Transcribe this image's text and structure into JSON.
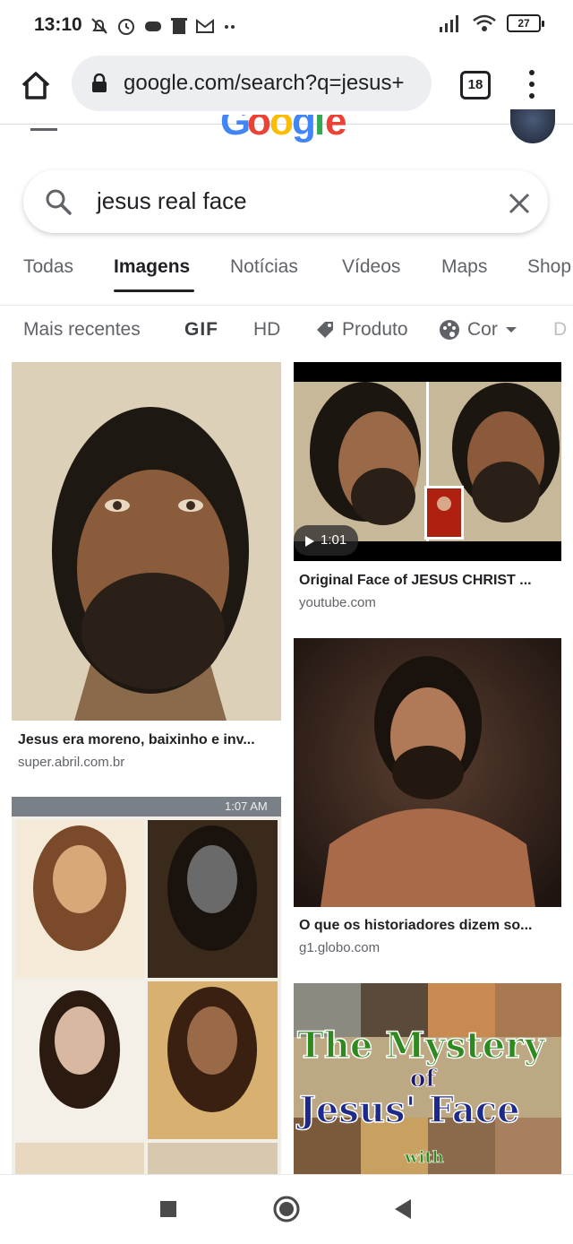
{
  "status_bar": {
    "time": "13:10",
    "battery": "27"
  },
  "browser": {
    "url": "google.com/search?q=jesus+",
    "tab_count": "18"
  },
  "search": {
    "query": "jesus real face"
  },
  "tabs": [
    "Todas",
    "Imagens",
    "Notícias",
    "Vídeos",
    "Maps",
    "Shop"
  ],
  "active_tab": "Imagens",
  "chips": {
    "recent": "Mais recentes",
    "gif": "GIF",
    "hd": "HD",
    "product": "Produto",
    "color": "Cor",
    "more": "D"
  },
  "results": [
    {
      "caption": "Jesus era moreno, baixinho e inv...",
      "source": "super.abril.com.br"
    },
    {
      "caption": "Original Face of JESUS CHRIST ...",
      "source": "youtube.com",
      "duration": "1:01"
    },
    {
      "caption": "O que os historiadores dizem so...",
      "source": "g1.globo.com"
    },
    {
      "overlay_time": "1:07 AM"
    },
    {
      "title_line1": "The Mystery",
      "title_line2": "of",
      "title_line3": "Jesus' Face",
      "title_line4": "with"
    }
  ],
  "colors": {
    "active": "#202124",
    "muted": "#5f6368",
    "pill": "#eceef1"
  }
}
